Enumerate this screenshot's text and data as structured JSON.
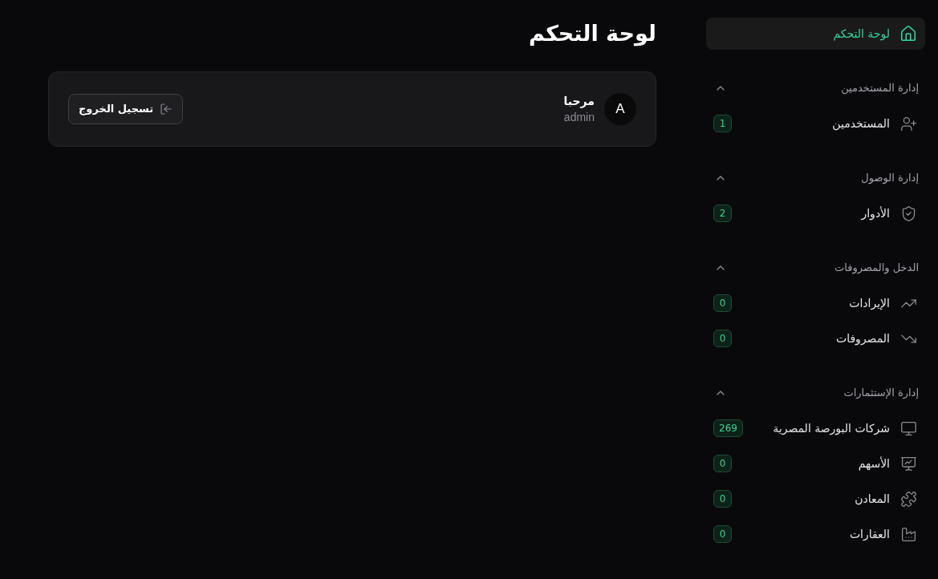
{
  "page_title": "لوحة التحكم",
  "user_card": {
    "avatar_letter": "A",
    "greeting": "مرحبا",
    "username": "admin",
    "logout_button": "تسجيل الخروج"
  },
  "sidebar": {
    "home": {
      "label": "لوحة التحكم",
      "selected": true
    },
    "groups": [
      {
        "title": "إدارة المستخدمين",
        "expanded": true,
        "items": [
          {
            "label": "المستخدمين",
            "count": "1",
            "selected": false
          }
        ]
      },
      {
        "title": "إدارة الوصول",
        "expanded": true,
        "items": [
          {
            "label": "الأدوار",
            "count": "2",
            "selected": false
          }
        ]
      },
      {
        "title": "الدخل والمصروفات",
        "expanded": true,
        "items": [
          {
            "label": "الإيرادات",
            "count": "0",
            "selected": false
          },
          {
            "label": "المصروفات",
            "count": "0",
            "selected": false
          }
        ]
      },
      {
        "title": "إدارة الإستثمارات",
        "expanded": true,
        "items": [
          {
            "label": "شركات البورصة المصرية",
            "count": "269",
            "selected": false
          },
          {
            "label": "الأسهم",
            "count": "0",
            "selected": false
          },
          {
            "label": "المعادن",
            "count": "0",
            "selected": false
          },
          {
            "label": "العقارات",
            "count": "0",
            "selected": false
          }
        ]
      }
    ]
  }
}
